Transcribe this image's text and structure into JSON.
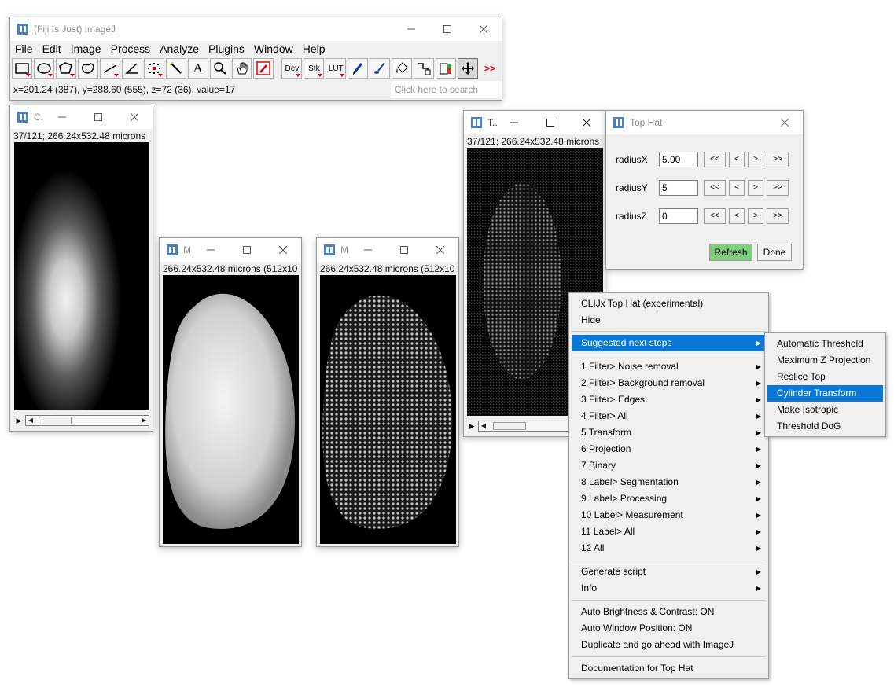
{
  "main_window": {
    "title": "(Fiji Is Just) ImageJ",
    "menus": [
      "File",
      "Edit",
      "Image",
      "Process",
      "Analyze",
      "Plugins",
      "Window",
      "Help"
    ],
    "tools": {
      "dev": "Dev",
      "stk": "Stk",
      "lut": "LUT",
      "text_tool": "A",
      "more": ">>"
    },
    "status": "x=201.24 (387), y=288.60 (555), z=72 (36), value=17",
    "search_placeholder": "Click here to search"
  },
  "image_windows": [
    {
      "title": "C.",
      "info": "37/121; 266.24x532.48 microns"
    },
    {
      "title": "M",
      "info": "266.24x532.48 microns (512x10"
    },
    {
      "title": "M",
      "info": "266.24x532.48 microns (512x10"
    },
    {
      "title": "T..",
      "info": "37/121; 266.24x532.48 microns"
    }
  ],
  "top_hat_dialog": {
    "title": "Top Hat",
    "params": [
      {
        "label": "radiusX",
        "value": "5.00"
      },
      {
        "label": "radiusY",
        "value": "5"
      },
      {
        "label": "radiusZ",
        "value": "0"
      }
    ],
    "step_buttons": [
      "<<",
      "<",
      ">",
      ">>"
    ],
    "refresh": "Refresh",
    "done": "Done"
  },
  "context_menu": {
    "header_items": [
      "CLIJx Top Hat (experimental)",
      "Hide"
    ],
    "suggested": "Suggested next steps",
    "categories": [
      "1 Filter> Noise removal",
      "2 Filter> Background removal",
      "3 Filter> Edges",
      "4 Filter> All",
      "5 Transform",
      "6 Projection",
      "7 Binary",
      "8 Label> Segmentation",
      "9 Label> Processing",
      "10 Label> Measurement",
      "11 Label> All",
      "12 All"
    ],
    "script_items": [
      "Generate script",
      "Info"
    ],
    "options": [
      "Auto Brightness & Contrast: ON",
      "Auto Window Position: ON",
      "Duplicate and go ahead with ImageJ"
    ],
    "documentation": "Documentation for Top Hat"
  },
  "submenu": {
    "items": [
      "Automatic Threshold",
      "Maximum Z Projection",
      "Reslice Top",
      "Cylinder Transform",
      "Make Isotropic",
      "Threshold DoG"
    ],
    "highlighted_index": 3
  },
  "colors": {
    "highlight": "#0a78d7",
    "refresh_button": "#7fcf7f",
    "window_bg": "#f0f0f0"
  }
}
